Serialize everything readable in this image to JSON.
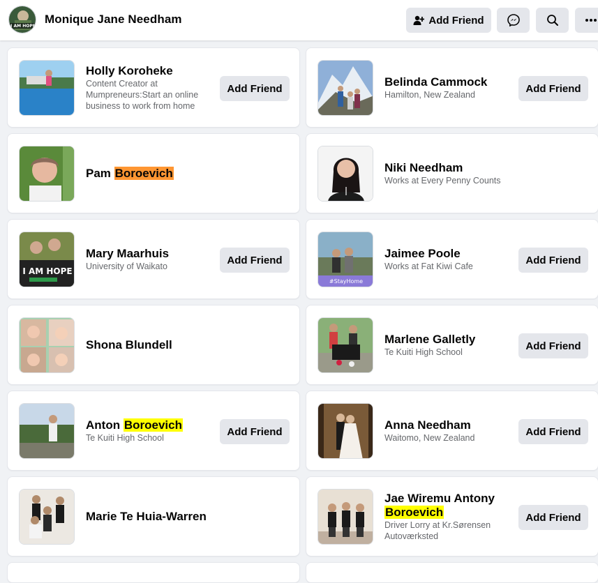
{
  "header": {
    "profile_name": "Monique Jane Needham",
    "avatar_text": "I AM HOPE",
    "add_friend_label": "Add Friend",
    "messenger_icon": "messenger-icon",
    "search_icon": "search-icon",
    "more_icon": "more-icon"
  },
  "colors": {
    "highlight_yellow": "#ffff00",
    "highlight_orange": "#ff9632",
    "button_bg": "#e4e6eb",
    "subtext": "#65676b"
  },
  "friends": [
    {
      "name": "Holly Koroheke",
      "name_pre": "Holly Koroheke",
      "name_hl": "",
      "name_post": "",
      "hl_color": "",
      "sub": "Content Creator at Mumpreneurs:Start an online business to work from home",
      "button": "Add Friend"
    },
    {
      "name": "Belinda Cammock",
      "name_pre": "Belinda Cammock",
      "name_hl": "",
      "name_post": "",
      "hl_color": "",
      "sub": "Hamilton, New Zealand",
      "button": "Add Friend"
    },
    {
      "name": "Pam Boroevich",
      "name_pre": "Pam ",
      "name_hl": "Boroevich",
      "name_post": "",
      "hl_color": "#ff9632",
      "sub": "",
      "button": ""
    },
    {
      "name": "Niki Needham",
      "name_pre": "Niki Needham",
      "name_hl": "",
      "name_post": "",
      "hl_color": "",
      "sub": "Works at Every Penny Counts",
      "button": ""
    },
    {
      "name": "Mary Maarhuis",
      "name_pre": "Mary Maarhuis",
      "name_hl": "",
      "name_post": "",
      "hl_color": "",
      "sub": "University of Waikato",
      "button": "Add Friend",
      "photo_text": "I AM HOPE"
    },
    {
      "name": "Jaimee Poole",
      "name_pre": "Jaimee Poole",
      "name_hl": "",
      "name_post": "",
      "hl_color": "",
      "sub": "Works at Fat Kiwi Cafe",
      "button": "Add Friend",
      "photo_text": "#StayHome"
    },
    {
      "name": "Shona Blundell",
      "name_pre": "Shona Blundell",
      "name_hl": "",
      "name_post": "",
      "hl_color": "",
      "sub": "",
      "button": ""
    },
    {
      "name": "Marlene Galletly",
      "name_pre": "Marlene Galletly",
      "name_hl": "",
      "name_post": "",
      "hl_color": "",
      "sub": "Te Kuiti High School",
      "button": "Add Friend"
    },
    {
      "name": "Anton Boroevich",
      "name_pre": "Anton ",
      "name_hl": "Boroevich",
      "name_post": "",
      "hl_color": "#ffff00",
      "sub": "Te Kuiti High School",
      "button": "Add Friend"
    },
    {
      "name": "Anna Needham",
      "name_pre": "Anna Needham",
      "name_hl": "",
      "name_post": "",
      "hl_color": "",
      "sub": "Waitomo, New Zealand",
      "button": "Add Friend"
    },
    {
      "name": "Marie Te Huia-Warren",
      "name_pre": "Marie Te Huia-Warren",
      "name_hl": "",
      "name_post": "",
      "hl_color": "",
      "sub": "",
      "button": ""
    },
    {
      "name": "Jae Wiremu Antony Boroevich",
      "name_pre": "Jae Wiremu Antony ",
      "name_hl": "Boroevich",
      "name_post": "",
      "hl_color": "#ffff00",
      "sub": "Driver Lorry at Kr.Sørensen Autoværksted",
      "button": "Add Friend"
    }
  ]
}
